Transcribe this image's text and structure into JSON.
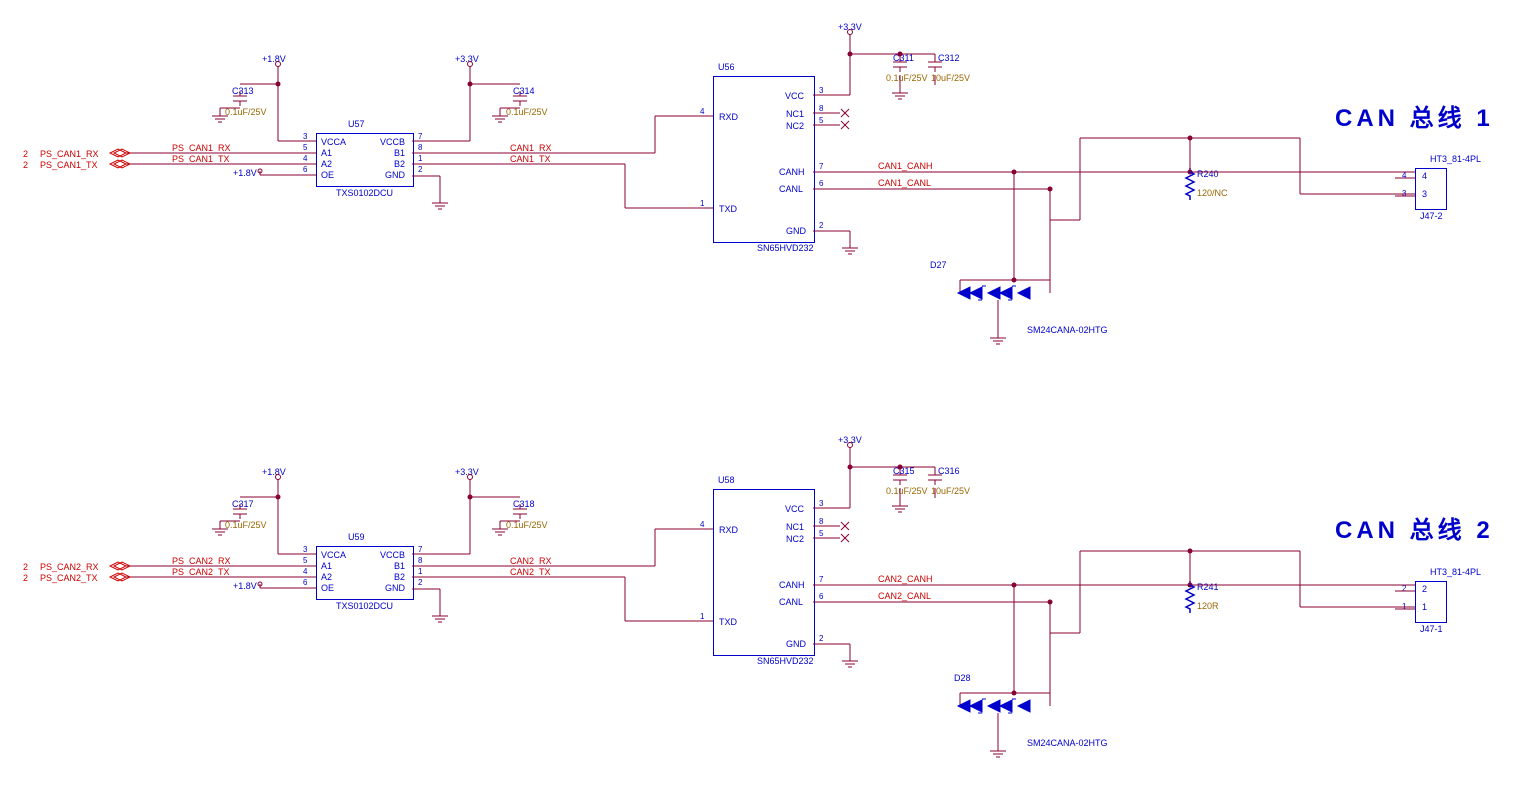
{
  "titles": {
    "t1": "CAN 总线 1",
    "t2": "CAN 总线 2"
  },
  "ch1": {
    "v18": "+1.8V",
    "v33": "+3.3V",
    "ps_rx": "PS_CAN1_RX",
    "ps_tx": "PS_CAN1_TX",
    "u57": "U57",
    "u57part": "TXS0102DCU",
    "u56": "U56",
    "u56part": "SN65HVD232",
    "c313": "C313",
    "c313v": "0.1uF/25V",
    "c314": "C314",
    "c314v": "0.1uF/25V",
    "c311": "C311",
    "c311v": "0.1uF/25V",
    "c312": "C312",
    "c312v": "10uF/25V",
    "can_rx": "CAN1_RX",
    "can_tx": "CAN1_TX",
    "canh": "CAN1_CANH",
    "canl": "CAN1_CANL",
    "r240": "R240",
    "r240v": "120/NC",
    "d27": "D27",
    "d27part": "SM24CANA-02HTG",
    "conn": "HT3_81-4PL",
    "connref": "J47-2",
    "connpin4": "4",
    "connpin3": "3",
    "offpage2a": "2",
    "offpage2b": "2"
  },
  "ch2": {
    "v18": "+1.8V",
    "v33": "+3.3V",
    "ps_rx": "PS_CAN2_RX",
    "ps_tx": "PS_CAN2_TX",
    "u59": "U59",
    "u59part": "TXS0102DCU",
    "u58": "U58",
    "u58part": "SN65HVD232",
    "c317": "C317",
    "c317v": "0.1uF/25V",
    "c318": "C318",
    "c318v": "0.1uF/25V",
    "c315": "C315",
    "c315v": "0.1uF/25V",
    "c316": "C316",
    "c316v": "10uF/25V",
    "can_rx": "CAN2_RX",
    "can_tx": "CAN2_TX",
    "canh": "CAN2_CANH",
    "canl": "CAN2_CANL",
    "r241": "R241",
    "r241v": "120R",
    "d28": "D28",
    "d28part": "SM24CANA-02HTG",
    "conn": "HT3_81-4PL",
    "connref": "J47-1",
    "connpin2": "2",
    "connpin1": "1",
    "offpage2a": "2",
    "offpage2b": "2"
  },
  "pins": {
    "vcca": "VCCA",
    "vccb": "VCCB",
    "a1": "A1",
    "b1": "B1",
    "a2": "A2",
    "b2": "B2",
    "oe": "OE",
    "gnd": "GND",
    "vcc": "VCC",
    "nc1": "NC1",
    "nc2": "NC2",
    "rxd": "RXD",
    "txd": "TXD",
    "canh_p": "CANH",
    "canl_p": "CANL",
    "p1": "1",
    "p2": "2",
    "p3": "3",
    "p4": "4",
    "p5": "5",
    "p6": "6",
    "p7": "7",
    "p8": "8"
  }
}
